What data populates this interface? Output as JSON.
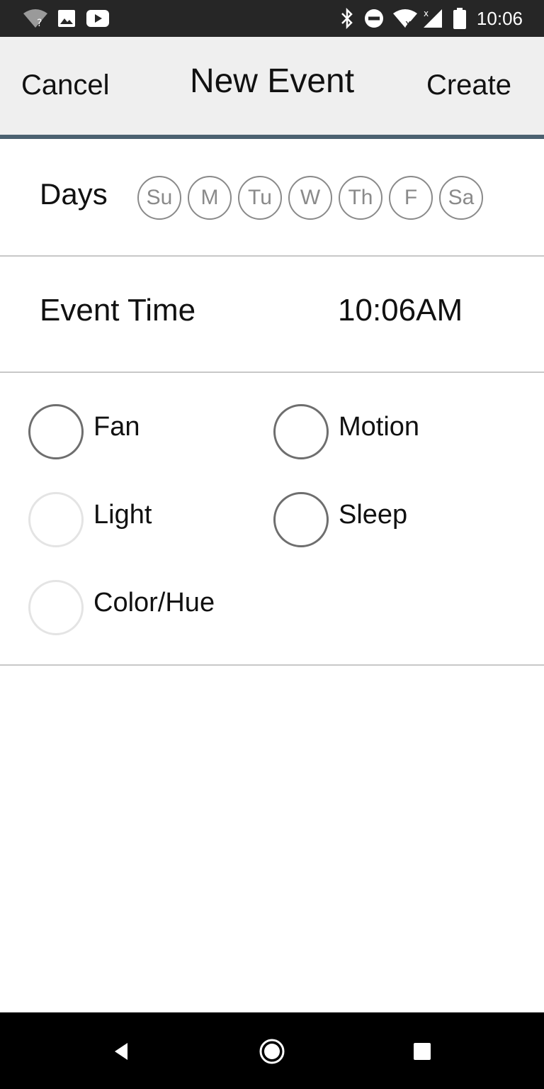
{
  "status_bar": {
    "time": "10:06",
    "left_icons": [
      "wifi-question-icon",
      "image-icon",
      "youtube-icon"
    ],
    "right_icons": [
      "bluetooth-icon",
      "do-not-disturb-icon",
      "wifi-off-icon",
      "cell-signal-icon",
      "battery-icon"
    ]
  },
  "header": {
    "cancel_label": "Cancel",
    "title": "New Event",
    "create_label": "Create"
  },
  "days": {
    "label": "Days",
    "items": [
      "Su",
      "M",
      "Tu",
      "W",
      "Th",
      "F",
      "Sa"
    ]
  },
  "event_time": {
    "label": "Event Time",
    "value": "10:06AM"
  },
  "options": [
    {
      "label": "Fan",
      "enabled": true
    },
    {
      "label": "Motion",
      "enabled": true
    },
    {
      "label": "Light",
      "enabled": false
    },
    {
      "label": "Sleep",
      "enabled": true
    },
    {
      "label": "Color/Hue",
      "enabled": false
    }
  ],
  "nav_bar": {
    "icons": [
      "back-icon",
      "home-icon",
      "recents-icon"
    ]
  },
  "colors": {
    "status_bar_bg": "#262626",
    "header_bg": "#efefef",
    "header_rule": "#4b6170",
    "nav_bar_bg": "#000000"
  }
}
